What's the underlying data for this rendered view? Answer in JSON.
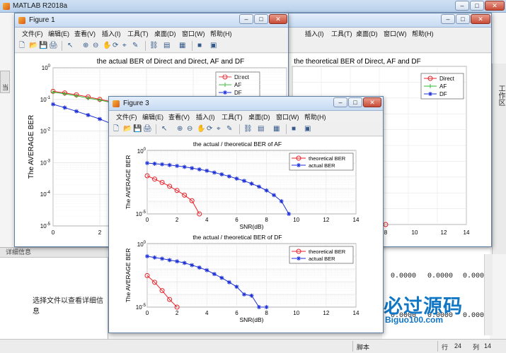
{
  "app": {
    "title": "MATLAB R2018a",
    "left_tab": "当",
    "right_tab": "工作区",
    "details_header": "详细信息",
    "details_hint": "选择文件以查看详细信息",
    "workspace_values": [
      "0.0000",
      "0.0000",
      "0.0000",
      "0.0000",
      "0.0000",
      "0.0000"
    ],
    "status": {
      "script": "脚本",
      "row_label": "行",
      "row_value": "24",
      "col_label": "列",
      "col_value": "14"
    },
    "watermark": {
      "main": "必过源码",
      "sub": "Biguo100.com"
    },
    "window_buttons": {
      "minimize": "–",
      "maximize": "□",
      "close": "✕"
    }
  },
  "menus": {
    "full": [
      "文件(F)",
      "编辑(E)",
      "查看(V)",
      "插入(I)",
      "工具(T)",
      "桌面(D)",
      "窗口(W)",
      "帮助(H)"
    ],
    "truncated": [
      "插入(I)",
      "工具(T)",
      "桌面(D)",
      "窗口(W)",
      "帮助(H)"
    ]
  },
  "toolbar_icons": [
    "new-file-icon",
    "open-folder-icon",
    "save-icon",
    "print-icon",
    "pointer-icon",
    "zoom-in-icon",
    "zoom-out-icon",
    "pan-icon",
    "rotate-icon",
    "data-cursor-icon",
    "brush-icon",
    "link-icon",
    "colorbar-icon",
    "legend-icon",
    "hide-tools-icon",
    "dock-icon"
  ],
  "figures": {
    "fig1": {
      "title": "Figure 1",
      "chart_title": "the actual BER of Direct and Direct, AF and DF",
      "ylabel": "The AVERAGE BER"
    },
    "fig2": {
      "chart_title": "the theoretical BER of Direct, AF and DF"
    },
    "fig3": {
      "title": "Figure 3"
    }
  },
  "chart_data": [
    {
      "id": "fig1",
      "type": "line",
      "title": "the actual BER of Direct and Direct, AF and DF",
      "ylabel": "The AVERAGE BER",
      "xlabel": "",
      "yscale": "log",
      "ylim": [
        1e-05,
        1
      ],
      "yticks": [
        "10^0",
        "10^-1",
        "10^-2",
        "10^-3",
        "10^-4",
        "10^-5"
      ],
      "xticks": [
        "0",
        "2"
      ],
      "grid": true,
      "legend": "top-right",
      "series": [
        {
          "name": "Direct",
          "color": "#e8222a",
          "marker": "circle",
          "x": [
            0,
            0.5,
            1,
            1.5,
            2,
            2.5,
            3,
            3.5,
            4
          ],
          "y": [
            0.18,
            0.16,
            0.14,
            0.12,
            0.1,
            0.085,
            0.07,
            0.055,
            0.042
          ]
        },
        {
          "name": "AF",
          "color": "#2db82d",
          "marker": "plus",
          "x": [
            0,
            0.5,
            1,
            1.5,
            2,
            2.5,
            3,
            3.5,
            4
          ],
          "y": [
            0.17,
            0.15,
            0.13,
            0.11,
            0.095,
            0.08,
            0.065,
            0.05,
            0.038
          ]
        },
        {
          "name": "DF",
          "color": "#1c2fd6",
          "marker": "star",
          "x": [
            0,
            0.5,
            1,
            1.5,
            2,
            2.5,
            3,
            3.5,
            4
          ],
          "y": [
            0.07,
            0.055,
            0.042,
            0.032,
            0.024,
            0.017,
            0.012,
            0.0085,
            0.006
          ]
        }
      ]
    },
    {
      "id": "fig2",
      "type": "line",
      "title": "the theoretical BER of Direct, AF and DF",
      "xlim": [
        0,
        14
      ],
      "xticks": [
        "8",
        "10",
        "12",
        "14"
      ],
      "grid": true,
      "legend": "top-right",
      "series": [
        {
          "name": "Direct",
          "color": "#e8222a",
          "marker": "circle"
        },
        {
          "name": "AF",
          "color": "#2db82d",
          "marker": "plus"
        },
        {
          "name": "DF",
          "color": "#1c2fd6",
          "marker": "star"
        }
      ]
    },
    {
      "id": "fig3-top",
      "type": "line",
      "title": "the actual / theoretical BER of AF",
      "xlabel": "SNR(dB)",
      "ylabel": "The AVERAGE BER",
      "yscale": "log",
      "ylim": [
        1e-05,
        1
      ],
      "xlim": [
        0,
        14
      ],
      "xticks": [
        "0",
        "2",
        "4",
        "6",
        "8",
        "10",
        "12",
        "14"
      ],
      "yticks": [
        "10^0",
        "10^-5"
      ],
      "grid": true,
      "legend": "top-right",
      "series": [
        {
          "name": "theoretical BER",
          "color": "#e8222a",
          "marker": "circle",
          "x": [
            0,
            0.5,
            1,
            1.5,
            2,
            2.5,
            3,
            3.5
          ],
          "y": [
            0.01,
            0.0055,
            0.003,
            0.0015,
            0.0007,
            0.0003,
            0.00011,
            1e-05
          ]
        },
        {
          "name": "actual BER",
          "color": "#1c2fd6",
          "marker": "star",
          "x": [
            0,
            0.5,
            1,
            1.5,
            2,
            2.5,
            3,
            3.5,
            4,
            4.5,
            5,
            5.5,
            6,
            6.5,
            7,
            7.5,
            8,
            8.5,
            9,
            9.5
          ],
          "y": [
            0.1,
            0.09,
            0.08,
            0.07,
            0.06,
            0.05,
            0.04,
            0.032,
            0.025,
            0.018,
            0.013,
            0.009,
            0.006,
            0.004,
            0.0024,
            0.0014,
            0.0007,
            0.0003,
            0.0001,
            1e-05
          ]
        }
      ]
    },
    {
      "id": "fig3-bottom",
      "type": "line",
      "title": "the actual / theoretical BER of DF",
      "xlabel": "SNR(dB)",
      "ylabel": "The AVERAGE BER",
      "yscale": "log",
      "ylim": [
        1e-05,
        1
      ],
      "xlim": [
        0,
        14
      ],
      "xticks": [
        "0",
        "2",
        "4",
        "6",
        "8",
        "10",
        "12",
        "14"
      ],
      "yticks": [
        "10^0",
        "10^-5"
      ],
      "grid": true,
      "legend": "top-right",
      "series": [
        {
          "name": "theoretical BER",
          "color": "#e8222a",
          "marker": "circle",
          "x": [
            0,
            0.5,
            1,
            1.5,
            2
          ],
          "y": [
            0.003,
            0.0009,
            0.0002,
            4e-05,
            1e-05
          ]
        },
        {
          "name": "actual BER",
          "color": "#1c2fd6",
          "marker": "star",
          "x": [
            0,
            0.5,
            1,
            1.5,
            2,
            2.5,
            3,
            3.5,
            4,
            4.5,
            5,
            5.5,
            6,
            6.5,
            7,
            7.5,
            8
          ],
          "y": [
            0.1,
            0.08,
            0.065,
            0.05,
            0.04,
            0.03,
            0.02,
            0.013,
            0.008,
            0.004,
            0.002,
            0.0009,
            0.0004,
            0.0001,
            8e-05,
            1e-05,
            1e-05
          ]
        }
      ]
    }
  ]
}
